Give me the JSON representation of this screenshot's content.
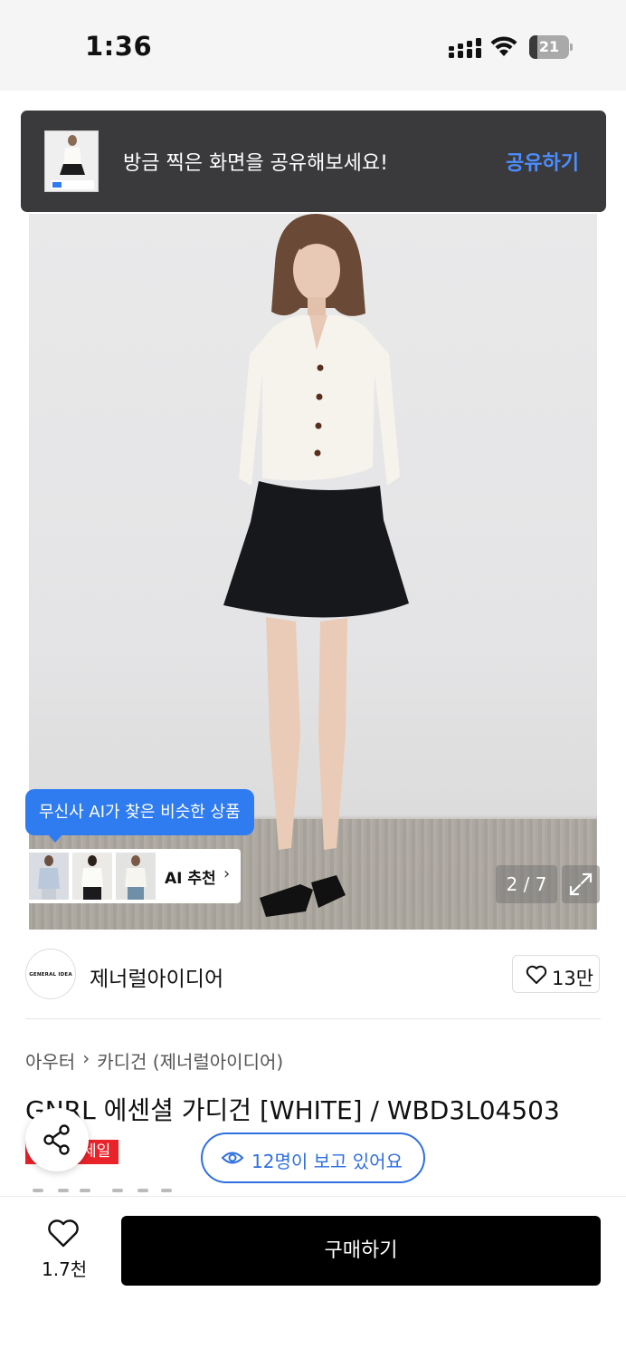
{
  "status_bar": {
    "time": "1:36",
    "battery": "21",
    "battery_fraction": 0.21,
    "icons": [
      "cellular-signal-icon",
      "wifi-icon",
      "battery-icon"
    ]
  },
  "share_toast": {
    "message": "방금 찍은 화면을 공유해보세요!",
    "action_label": "공유하기",
    "action_color": "#4c8dff"
  },
  "gallery": {
    "page_indicator": "2 / 7",
    "current_page": 2,
    "total_pages": 7
  },
  "ai_recommend": {
    "tooltip": "무신사 AI가 찾은 비슷한 상품",
    "label": "AI 추천",
    "accent_color": "#2f7bf0"
  },
  "brand": {
    "logo_text": "GENERAL IDEA",
    "name": "제너럴아이디어",
    "like_count": "13만"
  },
  "breadcrumb": {
    "category": "아우터",
    "subcategory": "카디건 (제너럴아이디어)"
  },
  "product": {
    "title": "GNRL 에센셜 가디건 [WHITE] / WBD3L04503",
    "sale_badge": "세일",
    "sale_color": "#e8232a"
  },
  "viewers": {
    "text": "12명이 보고 있어요",
    "color": "#2f6fe0"
  },
  "bottom_bar": {
    "favorite_count": "1.7천",
    "buy_label": "구매하기"
  }
}
